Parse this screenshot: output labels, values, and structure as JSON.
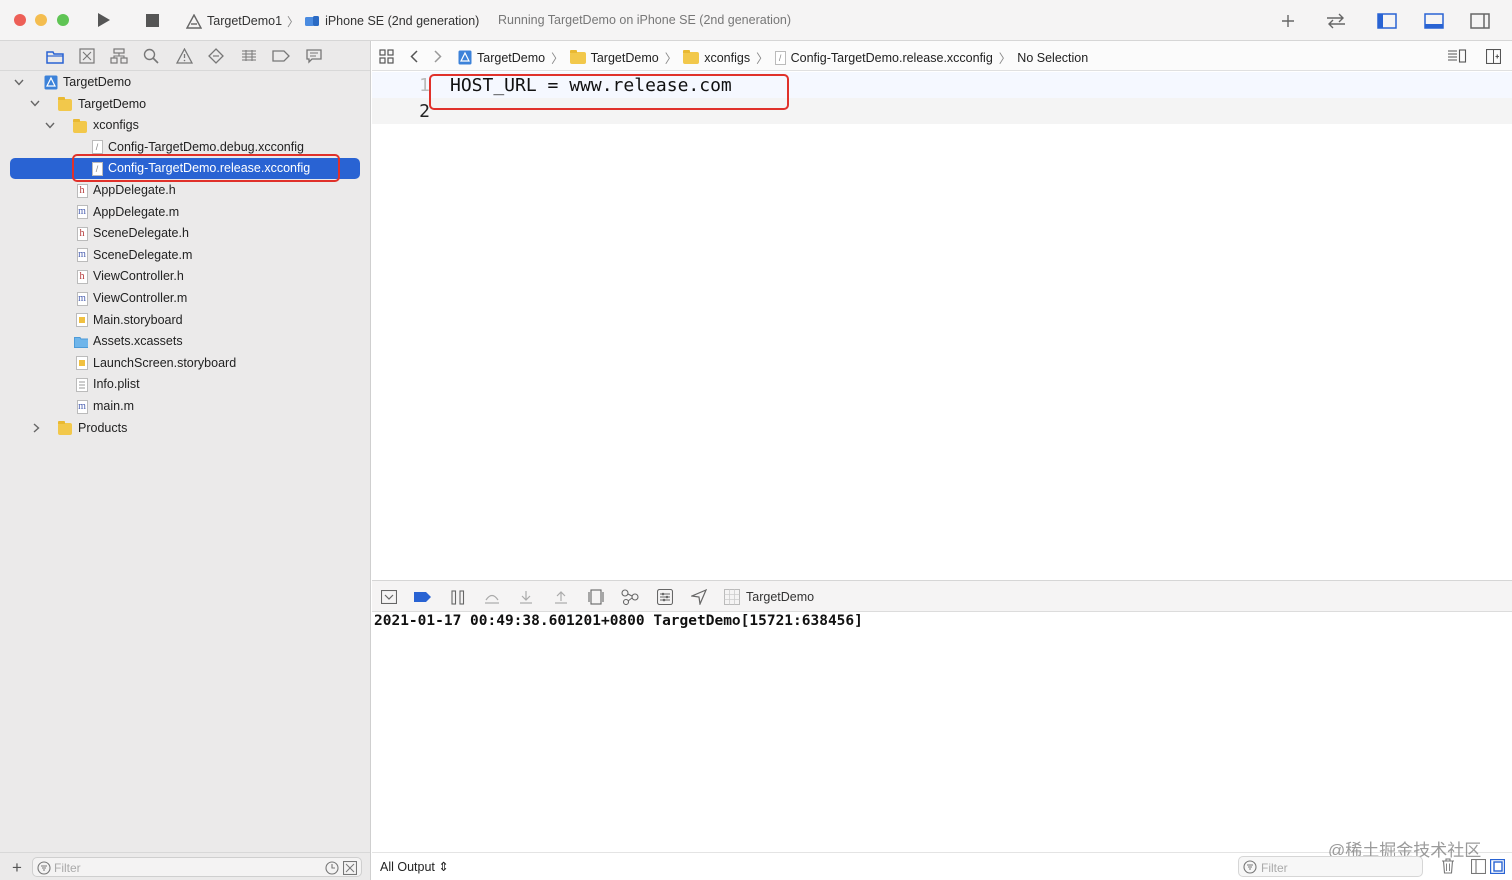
{
  "toolbar": {
    "scheme_name": "TargetDemo1",
    "device_name": "iPhone SE (2nd generation)",
    "status": "Running TargetDemo on iPhone SE (2nd generation)"
  },
  "navigator": {
    "tree": [
      {
        "label": "TargetDemo",
        "kind": "project"
      },
      {
        "label": "TargetDemo",
        "kind": "folder"
      },
      {
        "label": "xconfigs",
        "kind": "folder"
      },
      {
        "label": "Config-TargetDemo.debug.xcconfig",
        "kind": "xcconfig"
      },
      {
        "label": "Config-TargetDemo.release.xcconfig",
        "kind": "xcconfig",
        "selected": true
      },
      {
        "label": "AppDelegate.h",
        "kind": "h"
      },
      {
        "label": "AppDelegate.m",
        "kind": "m"
      },
      {
        "label": "SceneDelegate.h",
        "kind": "h"
      },
      {
        "label": "SceneDelegate.m",
        "kind": "m"
      },
      {
        "label": "ViewController.h",
        "kind": "h"
      },
      {
        "label": "ViewController.m",
        "kind": "m"
      },
      {
        "label": "Main.storyboard",
        "kind": "storyboard"
      },
      {
        "label": "Assets.xcassets",
        "kind": "assets"
      },
      {
        "label": "LaunchScreen.storyboard",
        "kind": "storyboard"
      },
      {
        "label": "Info.plist",
        "kind": "plist"
      },
      {
        "label": "main.m",
        "kind": "m"
      },
      {
        "label": "Products",
        "kind": "folder"
      }
    ],
    "filter_placeholder": "Filter",
    "file_glyphs": {
      "h": "h",
      "m": "m",
      "xcconfig": "/"
    }
  },
  "editor": {
    "breadcrumbs": [
      "TargetDemo",
      "TargetDemo",
      "xconfigs",
      "Config-TargetDemo.release.xcconfig",
      "No Selection"
    ],
    "line_numbers": [
      "1",
      "2"
    ],
    "lines": [
      "HOST_URL = www.release.com",
      ""
    ]
  },
  "debug": {
    "target": "TargetDemo",
    "console_line": "2021-01-17 00:49:38.601201+0800 TargetDemo[15721:638456]",
    "output_selector": "All Output ⇕",
    "filter_placeholder": "Filter",
    "watermark": "@稀土掘金技术社区"
  },
  "colors": {
    "accent": "#2963d3",
    "highlight_box": "#e0312a",
    "folder": "#f2c84b"
  }
}
